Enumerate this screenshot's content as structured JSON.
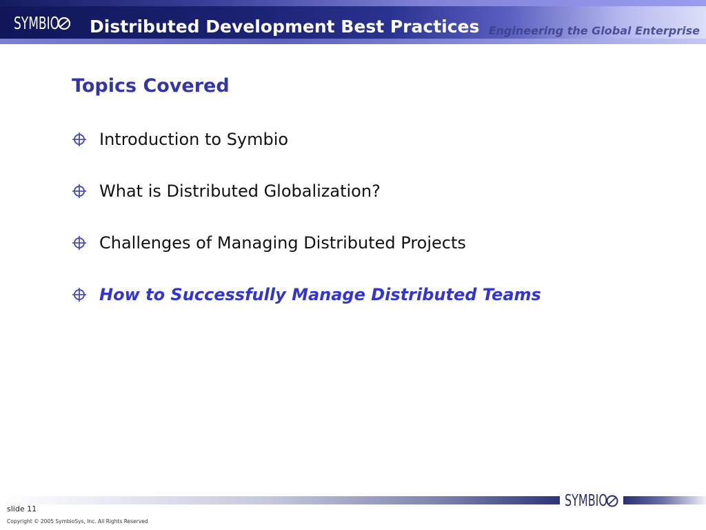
{
  "header": {
    "logo_text": "SYMBIO",
    "title": "Distributed Development Best Practices",
    "tagline": "Engineering the Global Enterprise"
  },
  "content": {
    "heading": "Topics Covered",
    "topics": [
      {
        "label": "Introduction to Symbio",
        "current": false
      },
      {
        "label": "What is Distributed Globalization?",
        "current": false
      },
      {
        "label": "Challenges of Managing Distributed Projects",
        "current": false
      },
      {
        "label": "How to Successfully Manage Distributed Teams",
        "current": true
      }
    ],
    "bullet_icon": "crosshair-circle-icon"
  },
  "footer": {
    "logo_text": "SYMBIO",
    "slide_number": "slide 11",
    "copyright": "Copyright © 2005 SymbioSys, Inc. All Rights Reserved"
  },
  "colors": {
    "brand_navy": "#1a2272",
    "heading_blue": "#3336a8",
    "highlight_blue": "#3336cc",
    "tagline_blue": "#3a3f8a"
  }
}
